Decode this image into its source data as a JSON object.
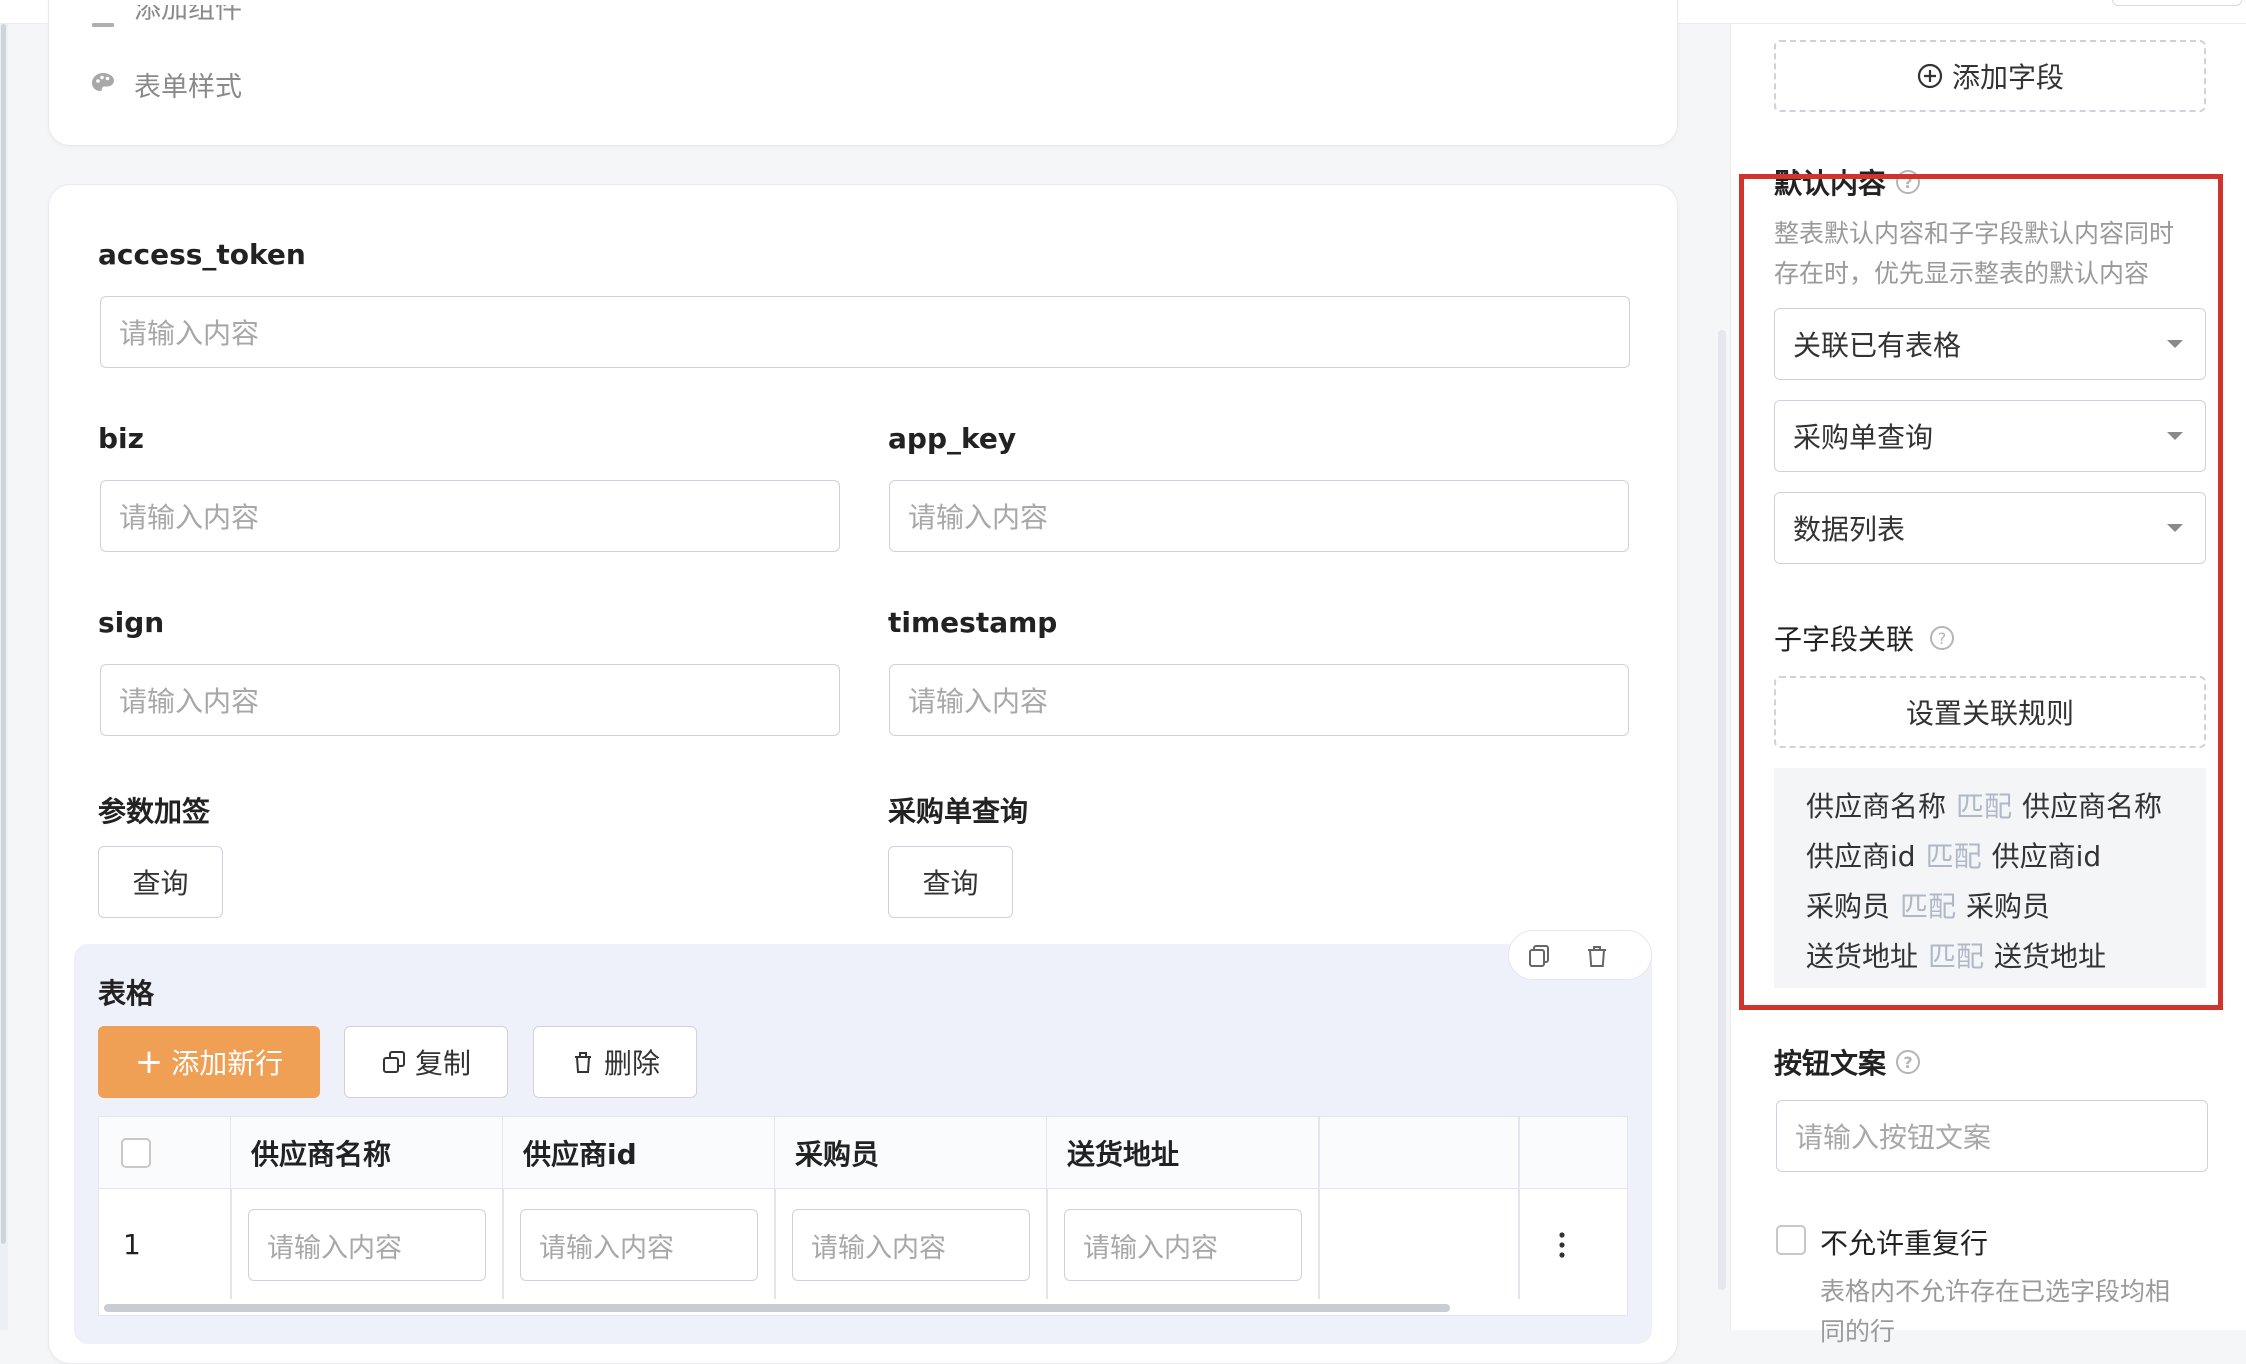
{
  "top_card": {
    "menu_partial": "添加组件",
    "menu_form_style": "表单样式"
  },
  "form": {
    "access_token": {
      "label": "access_token",
      "placeholder": "请输入内容"
    },
    "biz": {
      "label": "biz",
      "placeholder": "请输入内容"
    },
    "app_key": {
      "label": "app_key",
      "placeholder": "请输入内容"
    },
    "sign": {
      "label": "sign",
      "placeholder": "请输入内容"
    },
    "timestamp": {
      "label": "timestamp",
      "placeholder": "请输入内容"
    },
    "param_sign": {
      "label": "参数加签",
      "button": "查询"
    },
    "po_query": {
      "label": "采购单查询",
      "button": "查询"
    }
  },
  "table_block": {
    "title": "表格",
    "add_row": "添加新行",
    "copy": "复制",
    "delete": "删除",
    "columns": [
      "供应商名称",
      "供应商id",
      "采购员",
      "送货地址"
    ],
    "rows": [
      {
        "index": "1",
        "placeholders": [
          "请输入内容",
          "请输入内容",
          "请输入内容",
          "请输入内容"
        ]
      }
    ]
  },
  "right_panel": {
    "add_field": "添加字段",
    "default_content": {
      "title": "默认内容",
      "desc_line1": "整表默认内容和子字段默认内容同时",
      "desc_line2": "存在时，优先显示整表的默认内容",
      "select1": "关联已有表格",
      "select2": "采购单查询",
      "select3": "数据列表"
    },
    "sub_field": {
      "title": "子字段关联",
      "set_rule": "设置关联规则",
      "match_word": "匹配",
      "rules": [
        {
          "left": "供应商名称",
          "right": "供应商名称"
        },
        {
          "left": "供应商id",
          "right": "供应商id"
        },
        {
          "left": "采购员",
          "right": "采购员"
        },
        {
          "left": "送货地址",
          "right": "送货地址"
        }
      ]
    },
    "button_text": {
      "title": "按钮文案",
      "placeholder": "请输入按钮文案"
    },
    "no_dup": {
      "label": "不允许重复行",
      "desc_line1": "表格内不允许存在已选字段均相",
      "desc_line2": "同的行"
    },
    "help_glyph": "?"
  },
  "colors": {
    "accent": "#f0a055",
    "highlight_border": "#d0342c"
  }
}
